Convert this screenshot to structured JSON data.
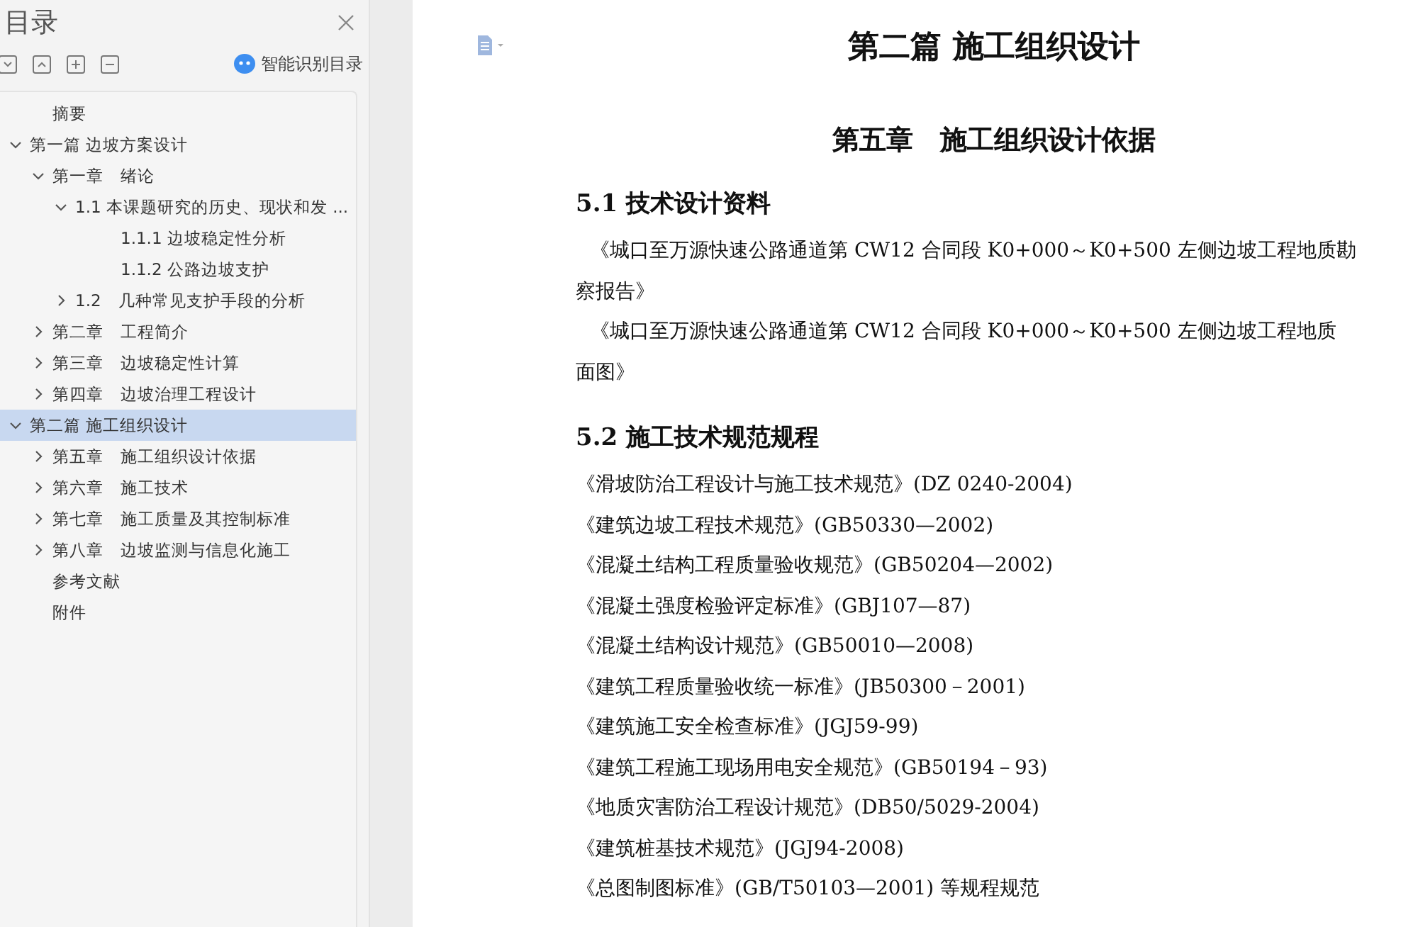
{
  "sidebar": {
    "title": "目录",
    "smart_button": "智能识别目录",
    "items": [
      {
        "kind": "leaf",
        "label": "摘要"
      },
      {
        "kind": "branch",
        "label": "第一篇 边坡方案设计",
        "expanded": true,
        "selected": false,
        "children": [
          {
            "kind": "branch",
            "label": "第一章　绪论",
            "expanded": true,
            "selected": false,
            "children": [
              {
                "kind": "branch",
                "label": "1.1  本课题研究的历史、现状和发 ...",
                "expanded": true,
                "selected": false,
                "children": [
                  {
                    "kind": "leaf",
                    "label": "1.1.1  边坡稳定性分析"
                  },
                  {
                    "kind": "leaf",
                    "label": "1.1.2 公路边坡支护"
                  }
                ]
              },
              {
                "kind": "branch",
                "label": "1.2　几种常见支护手段的分析",
                "expanded": false,
                "selected": false
              }
            ]
          },
          {
            "kind": "branch",
            "label": "第二章　工程简介",
            "expanded": false,
            "selected": false
          },
          {
            "kind": "branch",
            "label": "第三章　边坡稳定性计算",
            "expanded": false,
            "selected": false
          },
          {
            "kind": "branch",
            "label": "第四章　边坡治理工程设计",
            "expanded": false,
            "selected": false
          }
        ]
      },
      {
        "kind": "branch",
        "label": "第二篇 施工组织设计",
        "expanded": true,
        "selected": true,
        "children": [
          {
            "kind": "branch",
            "label": "第五章　施工组织设计依据",
            "expanded": false,
            "selected": false
          },
          {
            "kind": "branch",
            "label": "第六章　施工技术",
            "expanded": false,
            "selected": false
          },
          {
            "kind": "branch",
            "label": "第七章　施工质量及其控制标准",
            "expanded": false,
            "selected": false
          },
          {
            "kind": "branch",
            "label": "第八章　边坡监测与信息化施工",
            "expanded": false,
            "selected": false
          }
        ]
      },
      {
        "kind": "leaf",
        "label": "参考文献"
      },
      {
        "kind": "leaf",
        "label": "附件"
      }
    ]
  },
  "document": {
    "part_title": "第二篇  施工组织设计",
    "chapter_title": "第五章　施工组织设计依据",
    "sections": [
      {
        "heading": "5.1  技术设计资料",
        "kind": "indented",
        "lines": [
          "《城口至万源快速公路通道第 CW12 合同段 K0+000～K0+500 左侧边坡工程地质勘",
          "察报告》",
          "《城口至万源快速公路通道第 CW12 合同段 K0+000～K0+500 左侧边坡工程地质",
          "面图》"
        ]
      },
      {
        "heading": "5.2  施工技术规范规程",
        "kind": "list",
        "lines": [
          "《滑坡防治工程设计与施工技术规范》(DZ 0240-2004)",
          "《建筑边坡工程技术规范》(GB50330—2002)",
          "《混凝土结构工程质量验收规范》(GB50204—2002)",
          "《混凝土强度检验评定标准》(GBJ107—87)",
          "《混凝土结构设计规范》(GB50010—2008)",
          "《建筑工程质量验收统一标准》(JB50300－2001)",
          "《建筑施工安全检查标准》(JGJ59-99)",
          "《建筑工程施工现场用电安全规范》(GB50194－93)",
          "《地质灾害防治工程设计规范》(DB50/5029-2004)",
          "《建筑桩基技术规范》(JGJ94-2008)",
          "《总图制图标准》(GB/T50103—2001) 等规程规范"
        ]
      }
    ]
  }
}
